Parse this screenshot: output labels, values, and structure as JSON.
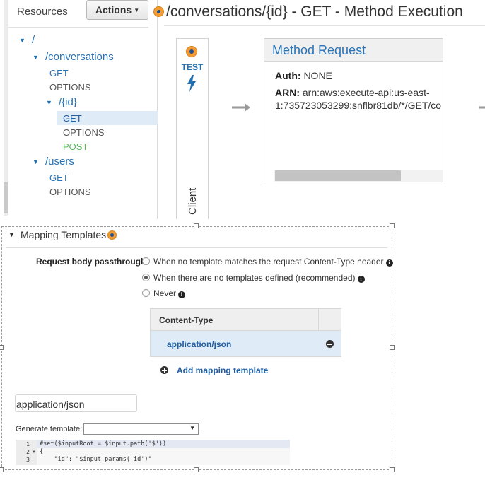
{
  "resources": {
    "header": "Resources",
    "actions_label": "Actions",
    "tree": {
      "root": "/",
      "conversations": "/conversations",
      "conversations_get": "GET",
      "conversations_options": "OPTIONS",
      "id": "/{id}",
      "id_get": "GET",
      "id_options": "OPTIONS",
      "id_post": "POST",
      "users": "/users",
      "users_get": "GET",
      "users_options": "OPTIONS"
    },
    "selected": "GET"
  },
  "page": {
    "title": "/conversations/{id} - GET - Method Execution"
  },
  "client": {
    "test_label": "TEST",
    "label": "Client"
  },
  "method_request": {
    "title": "Method Request",
    "auth_key": "Auth:",
    "auth_value": "NONE",
    "arn_key": "ARN:",
    "arn_value_line1": "arn:aws:execute-api:us-east-",
    "arn_value_line2": "1:735723053299:snflbr81db/*/GET/co"
  },
  "mapping_templates": {
    "title": "Mapping Templates",
    "passthrough_label": "Request body passthrough",
    "options": [
      {
        "label": "When no template matches the request Content-Type header",
        "checked": false
      },
      {
        "label": "When there are no templates defined (recommended)",
        "checked": true
      },
      {
        "label": "Never",
        "checked": false
      }
    ],
    "table_header": "Content-Type",
    "content_types": [
      "application/json"
    ],
    "add_label": "Add mapping template",
    "content_type_input": "application/json",
    "generate_label": "Generate template:",
    "generate_value": "",
    "code": {
      "line_numbers": [
        "1",
        "2",
        "3"
      ],
      "lines": [
        "#set($inputRoot = $input.path('$'))",
        "{",
        "    \"id\": \"$input.params('id')\""
      ]
    }
  },
  "colors": {
    "accent_blue": "#2a73b5",
    "post_green": "#5cb85c",
    "selected_row": "#dfecf8",
    "orange_badge": "#f39c35"
  }
}
